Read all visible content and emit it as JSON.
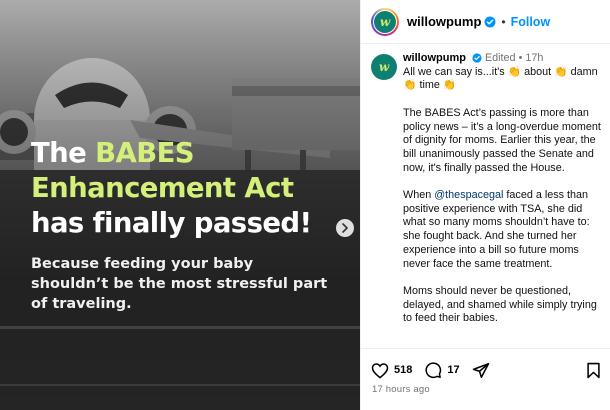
{
  "post": {
    "headline_line1_prefix": "The ",
    "headline_line1_highlight": "BABES",
    "headline_line2_highlight": "Enhancement Act",
    "headline_line3": "has finally passed!",
    "subhead": "Because feeding your baby shouldn’t be the most stressful part of traveling."
  },
  "header": {
    "username": "willowpump",
    "dot": "•",
    "follow_label": "Follow"
  },
  "caption": {
    "username": "willowpump",
    "edited": "Edited",
    "dot": "•",
    "age": "17h",
    "line1_a": "All we can say is...it's ",
    "line1_b": " about ",
    "line1_c": " damn",
    "line1_d": " time ",
    "p2": "The BABES Act’s passing is more than policy news – it’s a long-overdue moment of dignity for moms. Earlier this year, the bill unanimously passed the Senate and now, it's finally passed the House.",
    "p3_a": "When ",
    "p3_mention": "@thespacegal",
    "p3_b": " faced a less than positive experience with TSA, she did what so many moms shouldn’t have to: she fought back. And she turned her experience into a bill so future moms never face the same treatment.",
    "p4": "Moms should never be questioned, delayed, and shamed while simply trying to feed their babies."
  },
  "actions": {
    "likes": "518",
    "comments": "17",
    "timestamp": "17 hours ago"
  },
  "icons": {
    "like": "heart-icon",
    "comment": "comment-icon",
    "share": "share-icon",
    "save": "bookmark-icon",
    "verified": "verified-badge-icon",
    "clap": "clapping-hands-emoji",
    "next": "chevron-right-icon"
  },
  "colors": {
    "highlight": "#d4f07a",
    "follow": "#0095f6",
    "verified": "#0095f6",
    "mention": "#00376b",
    "brand": "#0f7f72"
  }
}
